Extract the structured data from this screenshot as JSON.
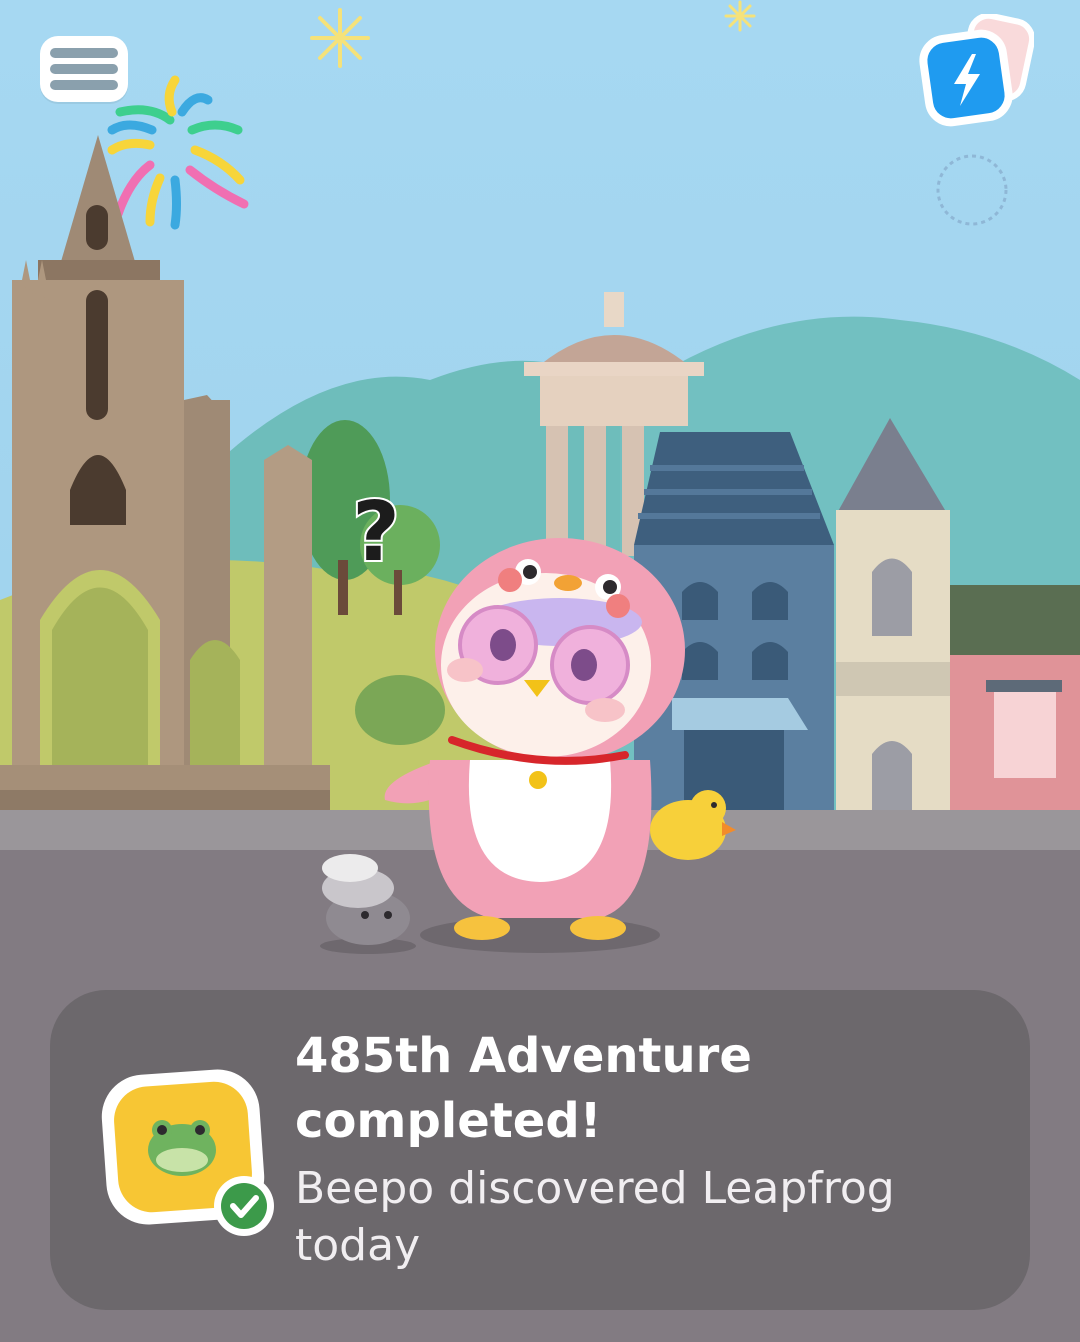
{
  "screen": {
    "title": "Adventure completed"
  },
  "top_bar": {
    "menu_icon": "hamburger-menu-icon",
    "energy_icon": "lightning-bolt-icon"
  },
  "scene": {
    "question_mark": "?",
    "character_icon": "pink-penguin-costume-pet",
    "duck_icon": "rubber-duck-icon",
    "rock_icon": "pet-rock-icon"
  },
  "adventure_card": {
    "title": "485th Adventure completed!",
    "subtitle": "Beepo discovered Leapfrog today",
    "badge_icon": "frog-icon",
    "check_icon": "checkmark-icon"
  },
  "colors": {
    "sky": "#9ed3ef",
    "card_bg": "#6c686c",
    "road": "#827b82",
    "badge_yellow": "#f7c634",
    "check_green": "#3c9a4a",
    "energy_blue": "#1f9bf0"
  }
}
